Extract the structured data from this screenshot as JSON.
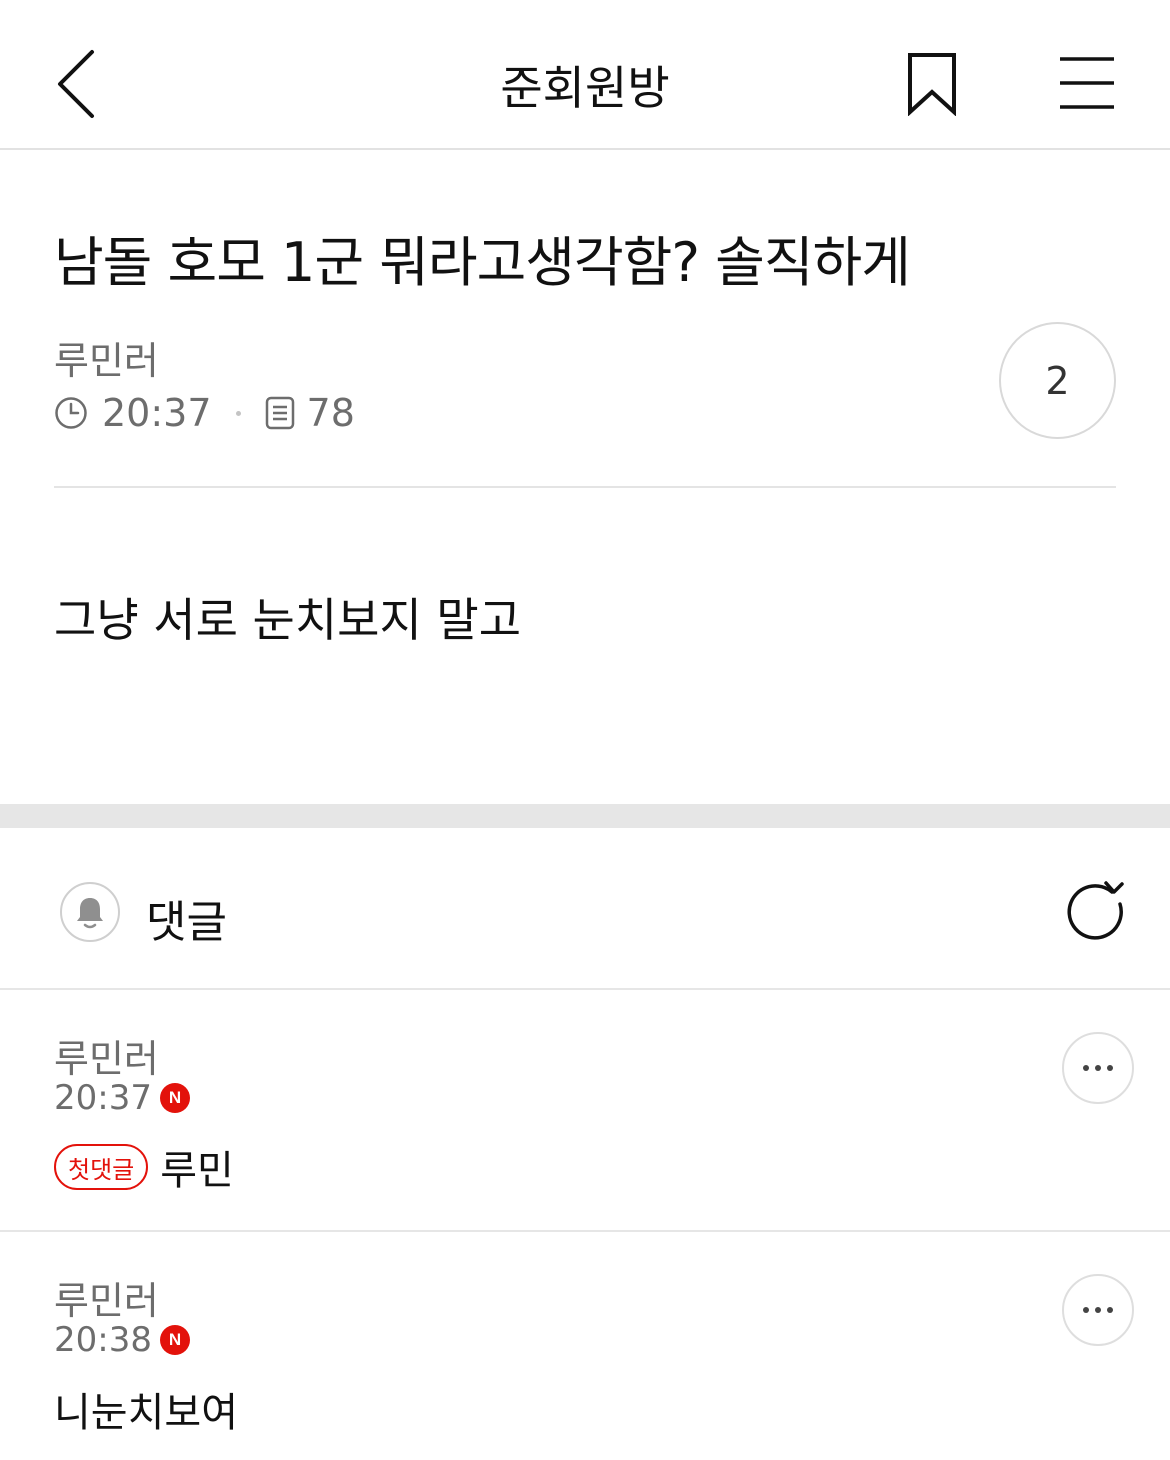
{
  "header": {
    "title": "준회원방",
    "back_icon": "chevron-left-icon",
    "bookmark_icon": "bookmark-icon",
    "menu_icon": "hamburger-menu-icon"
  },
  "post": {
    "title": "남돌 호모 1군 뭐라고생각함? 솔직하게",
    "author": "루민러",
    "time": "20:37",
    "views": "78",
    "comment_count": "2",
    "body": "그냥 서로 눈치보지 말고"
  },
  "comments_section": {
    "label": "댓글",
    "bell_icon": "bell-icon",
    "refresh_icon": "refresh-icon"
  },
  "comments": [
    {
      "author": "루민러",
      "time": "20:37",
      "new_badge": "N",
      "first_badge": "첫댓글",
      "text": "루민"
    },
    {
      "author": "루민러",
      "time": "20:38",
      "new_badge": "N",
      "text": "니눈치보여"
    }
  ],
  "colors": {
    "accent_red": "#e3120b",
    "meta_gray": "#6d6d6d",
    "divider": "#e6e6e6"
  }
}
